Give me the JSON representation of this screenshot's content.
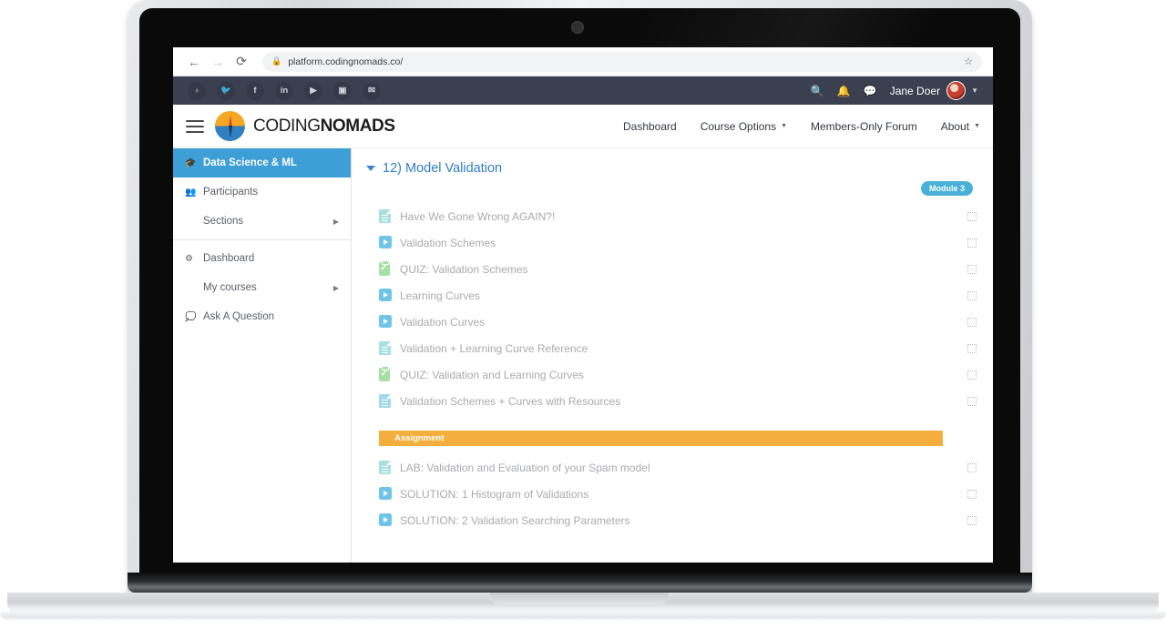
{
  "browser": {
    "back_icon": "back-arrow-icon",
    "forward_icon": "forward-arrow-icon",
    "reload_icon": "reload-icon",
    "lock_icon": "lock-icon",
    "url": "platform.codingnomads.co/",
    "star_icon": "bookmark-star-icon"
  },
  "social_bar": {
    "icons": [
      {
        "name": "globe-icon",
        "glyph": "♁"
      },
      {
        "name": "twitter-icon",
        "glyph": "🐦"
      },
      {
        "name": "facebook-icon",
        "glyph": "f"
      },
      {
        "name": "linkedin-icon",
        "glyph": "in"
      },
      {
        "name": "youtube-icon",
        "glyph": "▶"
      },
      {
        "name": "instagram-icon",
        "glyph": "▣"
      },
      {
        "name": "email-icon",
        "glyph": "✉"
      }
    ],
    "search_icon": "🔍",
    "bell_icon": "🔔",
    "chat_icon": "💬",
    "user_name": "Jane Doer",
    "caret": "▼"
  },
  "site_header": {
    "menu_icon": "hamburger-menu-icon",
    "logo_icon": "compass-logo-icon",
    "logo_thin": "CODING",
    "logo_bold": "NOMADS",
    "nav": [
      {
        "label": "Dashboard",
        "caret": ""
      },
      {
        "label": "Course Options",
        "caret": "▼"
      },
      {
        "label": "Members-Only Forum",
        "caret": ""
      },
      {
        "label": "About",
        "caret": "▼"
      }
    ]
  },
  "sidebar": {
    "items": [
      {
        "label": "Data Science & ML",
        "icon": "graduation-cap-icon",
        "glyph": "🎓",
        "active": true,
        "arrow": ""
      },
      {
        "label": "Participants",
        "icon": "users-icon",
        "glyph": "👥",
        "active": false,
        "arrow": ""
      },
      {
        "label": "Sections",
        "icon": "",
        "glyph": "",
        "active": false,
        "arrow": "▶"
      },
      {
        "label": "Dashboard",
        "icon": "gauge-icon",
        "glyph": "⚙",
        "active": false,
        "arrow": ""
      },
      {
        "label": "My courses",
        "icon": "",
        "glyph": "",
        "active": false,
        "arrow": "▶"
      },
      {
        "label": "Ask A Question",
        "icon": "comments-icon",
        "glyph": "💭",
        "active": false,
        "arrow": ""
      }
    ]
  },
  "content": {
    "section_title": "12) Model Validation",
    "toggle_icon": "collapse-triangle-icon",
    "module_badge": "Module 3",
    "activities": [
      {
        "label": "Have We Gone Wrong AGAIN?!",
        "type": "page"
      },
      {
        "label": "Validation Schemes",
        "type": "video"
      },
      {
        "label": "QUIZ: Validation Schemes",
        "type": "quiz"
      },
      {
        "label": "Learning Curves",
        "type": "video"
      },
      {
        "label": "Validation Curves",
        "type": "video"
      },
      {
        "label": "Validation + Learning Curve Reference",
        "type": "page"
      },
      {
        "label": "QUIZ: Validation and Learning Curves",
        "type": "quiz"
      },
      {
        "label": "Validation Schemes + Curves with Resources",
        "type": "page-blue"
      }
    ],
    "assignment_banner": "Assignment",
    "assignment_activities": [
      {
        "label": "LAB: Validation and Evaluation of your Spam model",
        "type": "page"
      },
      {
        "label": "SOLUTION: 1 Histogram of Validations",
        "type": "video"
      },
      {
        "label": "SOLUTION: 2 Validation Searching Parameters",
        "type": "video"
      }
    ]
  },
  "colors": {
    "accent_blue": "#3d9fd6",
    "title_blue": "#2f7fc4",
    "badge_blue": "#4ab0d8",
    "assignment_orange": "#f4ae3e",
    "navbar_dark": "#3a4050"
  }
}
